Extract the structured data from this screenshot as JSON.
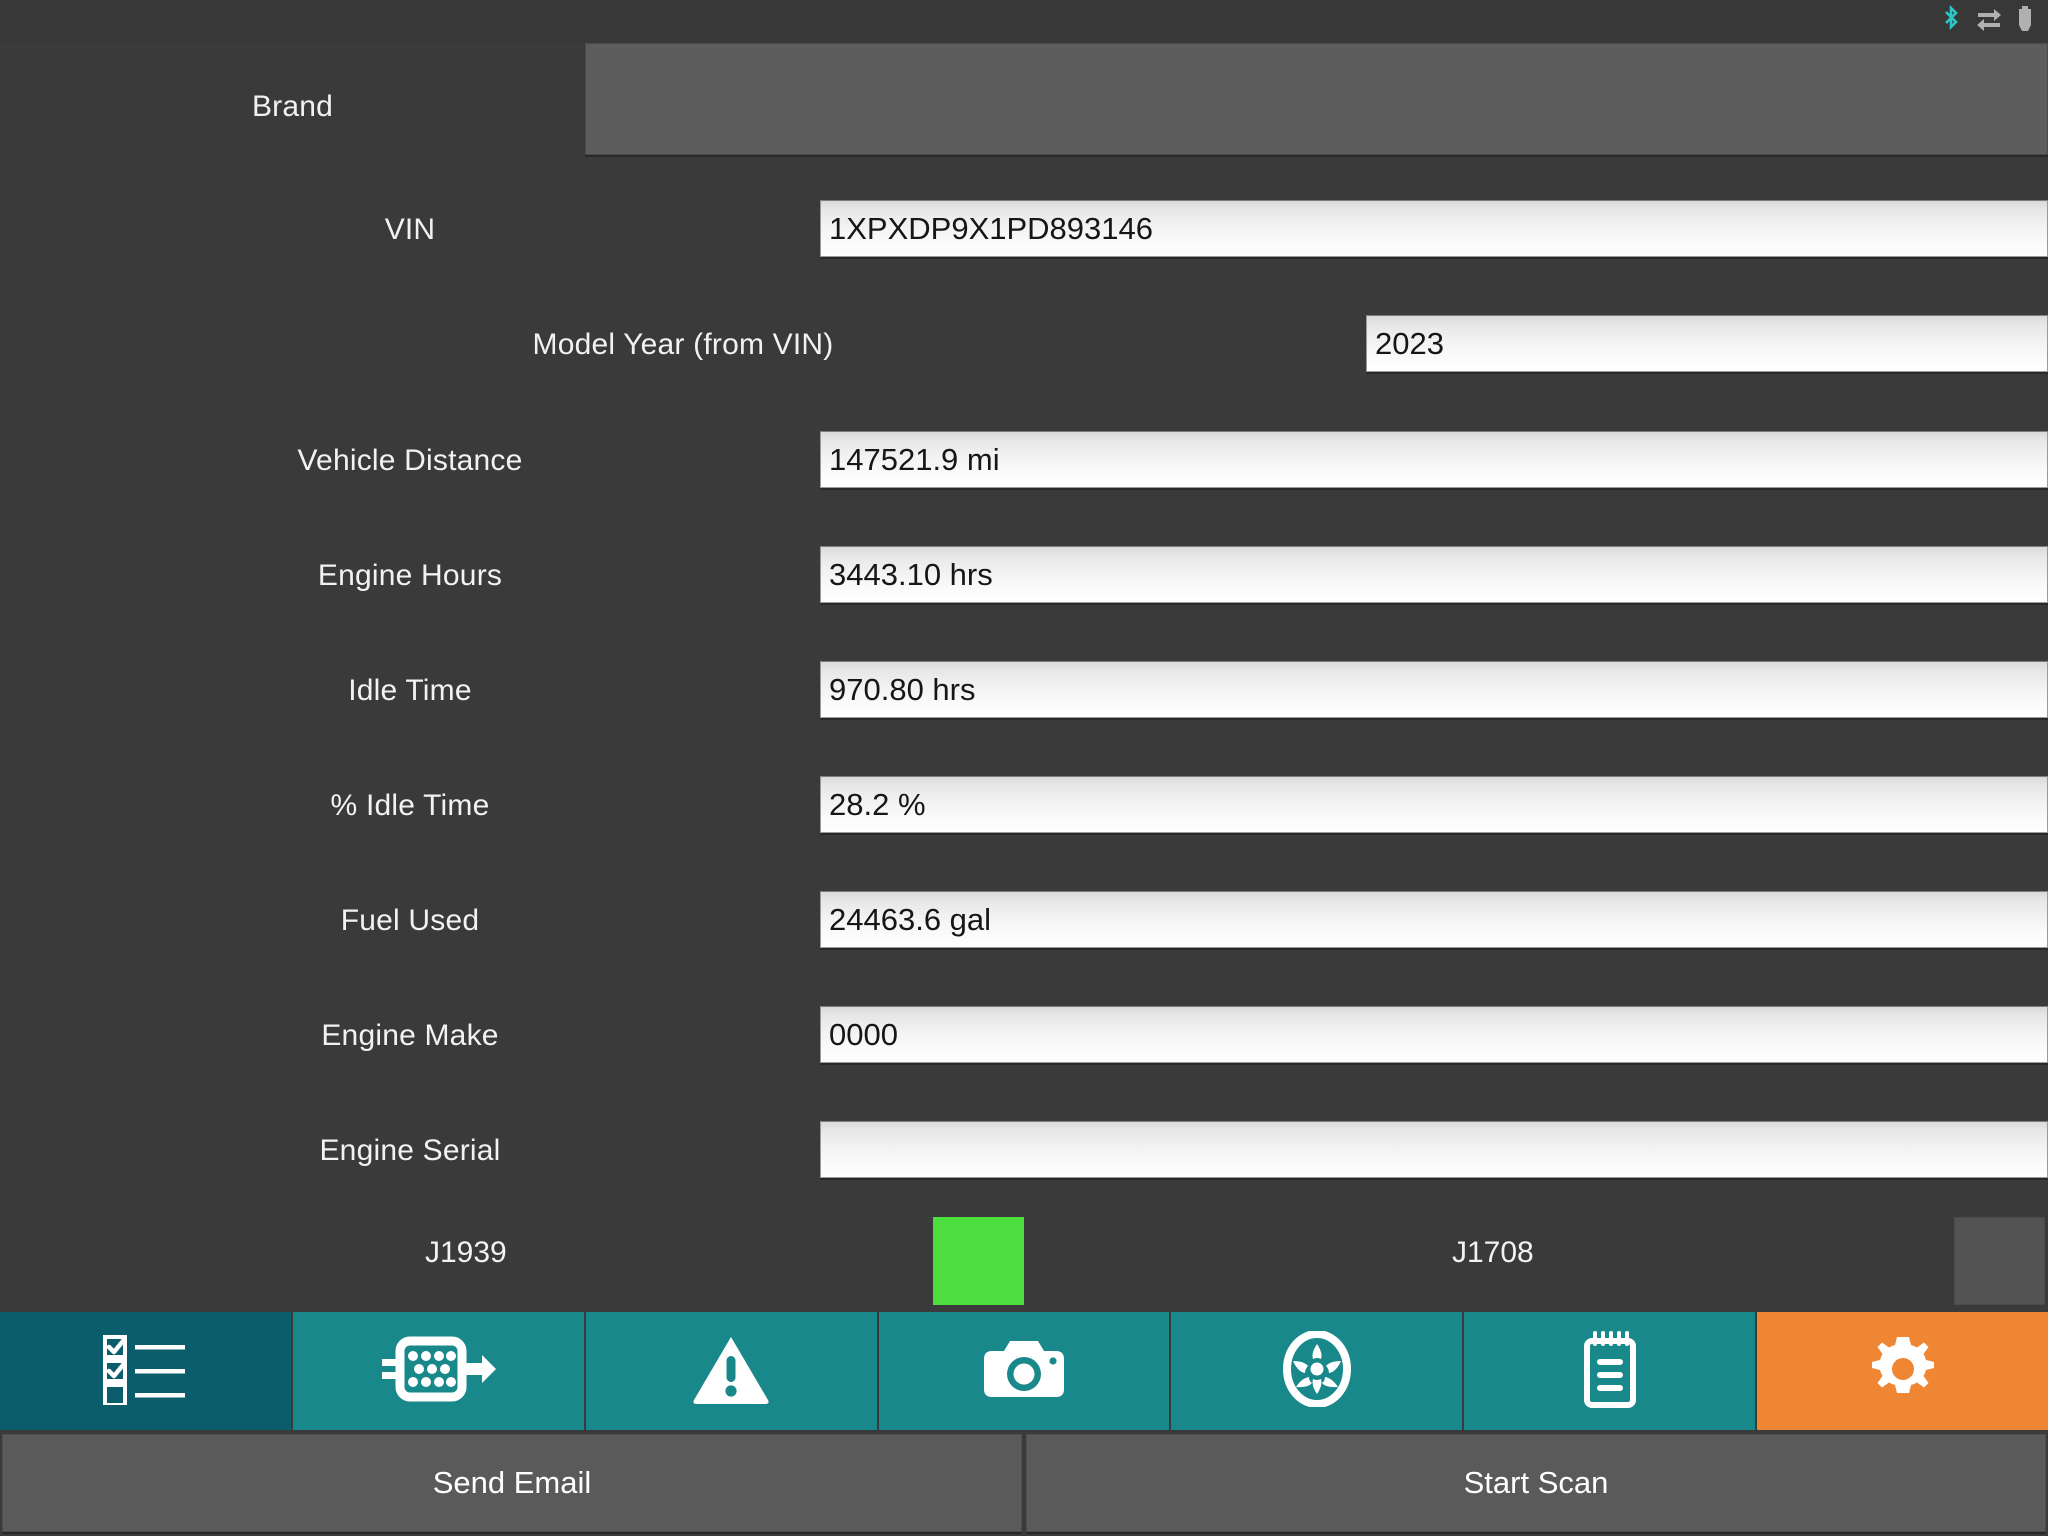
{
  "statusbar": {
    "icons": [
      {
        "name": "bluetooth-icon",
        "label": "Bluetooth",
        "color": "#2bc7c7"
      },
      {
        "name": "data-transfer-icon",
        "label": "Data transfer",
        "color": "#b0b0b0"
      },
      {
        "name": "battery-icon",
        "label": "Battery",
        "color": "#b0b0b0"
      }
    ]
  },
  "form": {
    "fields": [
      {
        "label": "Brand",
        "value": "",
        "placeholder": "",
        "type": "spinner"
      },
      {
        "label": "VIN",
        "value": "1XPXDP9X1PD893146",
        "placeholder": "",
        "type": "text"
      },
      {
        "label": "Model Year (from VIN)",
        "value": "2023",
        "placeholder": "",
        "type": "text"
      },
      {
        "label": "Vehicle Distance",
        "value": "147521.9 mi",
        "placeholder": "",
        "type": "text"
      },
      {
        "label": "Engine Hours",
        "value": "3443.10 hrs",
        "placeholder": "",
        "type": "text"
      },
      {
        "label": "Idle Time",
        "value": "970.80 hrs",
        "placeholder": "",
        "type": "text"
      },
      {
        "label": "% Idle Time",
        "value": "28.2 %",
        "placeholder": "",
        "type": "text"
      },
      {
        "label": "Fuel Used",
        "value": "24463.6 gal",
        "placeholder": "",
        "type": "text"
      },
      {
        "label": "Engine Make",
        "value": "0000",
        "placeholder": "",
        "type": "text"
      },
      {
        "label": "Engine Serial",
        "value": "",
        "placeholder": "",
        "type": "text"
      }
    ]
  },
  "protocols": [
    {
      "label": "J1939",
      "status": "on",
      "color": "#4CDE3E"
    },
    {
      "label": "J1708",
      "status": "off",
      "color": "#535353"
    }
  ],
  "tabbar": {
    "tabs": [
      {
        "name": "tab-checklist",
        "icon": "checklist-icon",
        "label": "Checklist",
        "state": "dark"
      },
      {
        "name": "tab-connector",
        "icon": "connector-icon",
        "label": "Connector",
        "state": "normal"
      },
      {
        "name": "tab-faults",
        "icon": "warning-icon",
        "label": "Faults",
        "state": "normal"
      },
      {
        "name": "tab-camera",
        "icon": "camera-icon",
        "label": "Camera",
        "state": "normal"
      },
      {
        "name": "tab-wheels",
        "icon": "wheel-icon",
        "label": "Wheels",
        "state": "normal"
      },
      {
        "name": "tab-notes",
        "icon": "notepad-icon",
        "label": "Notes",
        "state": "normal"
      },
      {
        "name": "tab-settings",
        "icon": "gear-icon",
        "label": "Settings",
        "state": "active"
      }
    ]
  },
  "actions": {
    "send_email_label": "Send Email",
    "start_scan_label": "Start Scan"
  },
  "colors": {
    "background": "#3a3a3a",
    "tab_teal": "#19888a",
    "tab_dark_teal": "#0b5d6b",
    "tab_active_orange": "#ef8633",
    "led_on_green": "#4CDE3E",
    "led_off_gray": "#535353",
    "bluetooth_cyan": "#2bc7c7"
  }
}
